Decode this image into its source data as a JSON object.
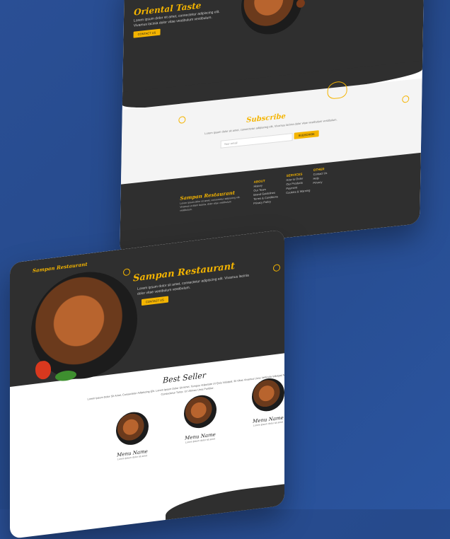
{
  "top_page": {
    "hero": {
      "title": "Oriental Taste",
      "text": "Lorem ipsum dolor sit amet, consectetur adipiscing elit. Vivamus lacinia dolor vitae vestibulum vestibulum.",
      "button": "CONTACT US"
    },
    "subscribe": {
      "title": "Subscribe",
      "text": "Lorem ipsum dolor sit amet, consectetur adipiscing elit, Vivamus lacinia dolor vitae vestibulum vestibulum.",
      "placeholder": "Your email",
      "button": "SUBSCRIBE"
    },
    "footer": {
      "brand": "Sampan Restaurant",
      "brand_text": "Lorem ipsum dolor sit amet, consectetur adipiscing elit. Vivamus ut diam lacinia, dolor vitae vestibulum vestibulum.",
      "columns": [
        {
          "title": "ABOUT",
          "items": [
            "History",
            "Our Team",
            "Brand Guidelines",
            "Terms & Conditions",
            "Privacy Policy"
          ]
        },
        {
          "title": "SERVICES",
          "items": [
            "How to Order",
            "Our Products",
            "Payment",
            "Cookies & Warning"
          ]
        },
        {
          "title": "OTHER",
          "items": [
            "Contact Us",
            "Help",
            "Privacy"
          ]
        }
      ]
    }
  },
  "bottom_page": {
    "brand": "Sampan Restaurant",
    "hero": {
      "title": "Sampan Restaurant",
      "text": "Lorem ipsum dolor sit amet, consectetur adipiscing elit. Vivamus lacinia dolor vitae vestibulum vestibulum.",
      "button": "CONTACT US"
    },
    "best_seller": {
      "title": "Best Seller",
      "text": "Lorem Ipsum Dolor Sit Amet, Consectetur Adipiscing Elit. Lorem Ipsum Dolor Sit Amet. Tempus Vulputate Ut Quis Volutpat. Et Vitae Vivamus Urna Vehicula Volutpat Nec Consectetur Tortor, Ut Ultrices Urna Porttitor."
    },
    "menu_items": [
      {
        "name": "Menu Name",
        "desc": "Lorem ipsum dolor sit amet"
      },
      {
        "name": "Menu Name",
        "desc": "Lorem ipsum dolor sit amet"
      },
      {
        "name": "Menu Name",
        "desc": "Lorem ipsum dolor sit amet"
      }
    ]
  },
  "colors": {
    "accent": "#f4b400",
    "dark": "#2f2f2f",
    "background": "#2a4f95"
  }
}
